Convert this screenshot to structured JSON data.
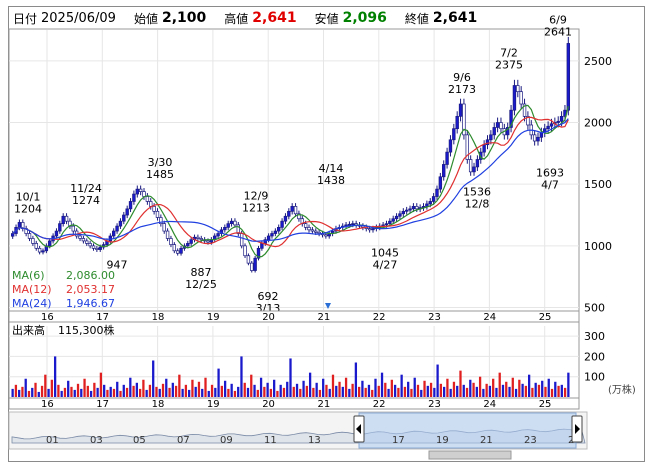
{
  "header": {
    "date_label": "日付",
    "date_value": "2025/06/09",
    "open_label": "始値",
    "open_value": "2,100",
    "high_label": "高値",
    "high_value": "2,641",
    "low_label": "安値",
    "low_value": "2,096",
    "close_label": "終値",
    "close_value": "2,641"
  },
  "legend": {
    "ma6_label": "MA(6)",
    "ma6_value": "2,086.00",
    "ma12_label": "MA(12)",
    "ma12_value": "2,053.17",
    "ma24_label": "MA(24)",
    "ma24_value": "1,946.67"
  },
  "volume": {
    "label": "出来高",
    "value": "115,300株",
    "unit": "(万株)"
  },
  "colors": {
    "up": "#1a1acc",
    "down": "#ffffff",
    "ma6": "#2e8b2e",
    "ma12": "#e03030",
    "ma24": "#2040e0",
    "vol_up": "#1a1acc",
    "vol_down": "#e02020"
  },
  "chart_data": [
    {
      "type": "candlestick",
      "ylim": [
        480,
        2750
      ],
      "y_ticks": [
        "2500",
        "2000",
        "1500",
        "1000",
        "500"
      ],
      "x_ticks": [
        "16",
        "17",
        "18",
        "19",
        "20",
        "21",
        "22",
        "23",
        "24",
        "25"
      ],
      "annotations": [
        {
          "date": "10/1",
          "value": "1204",
          "type": "high"
        },
        {
          "date": "11/24",
          "value": "1274",
          "type": "high"
        },
        {
          "date": "3/30",
          "value": "1485",
          "type": "high"
        },
        {
          "date": "12/9",
          "value": "1213",
          "type": "high"
        },
        {
          "date": "4/14",
          "value": "1438",
          "type": "high"
        },
        {
          "date": "9/6",
          "value": "2173",
          "type": "high"
        },
        {
          "date": "7/2",
          "value": "2375",
          "type": "high"
        },
        {
          "date": "6/9",
          "value": "2641",
          "type": "high"
        },
        {
          "date": "",
          "value": "947",
          "type": "low"
        },
        {
          "date": "12/25",
          "value": "887",
          "type": "low"
        },
        {
          "date": "3/13",
          "value": "692",
          "type": "low"
        },
        {
          "date": "4/27",
          "value": "1045",
          "type": "low"
        },
        {
          "date": "12/8",
          "value": "1536",
          "type": "low"
        },
        {
          "date": "4/7",
          "value": "1693",
          "type": "low"
        }
      ],
      "close_series": [
        1100,
        1150,
        1190,
        1140,
        1100,
        1060,
        1020,
        980,
        950,
        960,
        1000,
        1040,
        1080,
        1120,
        1180,
        1240,
        1200,
        1160,
        1120,
        1080,
        1060,
        1040,
        1020,
        1000,
        980,
        970,
        990,
        1010,
        1040,
        1080,
        1120,
        1160,
        1200,
        1250,
        1300,
        1360,
        1420,
        1460,
        1440,
        1400,
        1360,
        1320,
        1280,
        1230,
        1180,
        1120,
        1060,
        1010,
        960,
        940,
        980,
        1000,
        1020,
        1050,
        1070,
        1060,
        1050,
        1040,
        1030,
        1050,
        1080,
        1100,
        1130,
        1150,
        1180,
        1200,
        1170,
        1100,
        1000,
        920,
        860,
        800,
        900,
        980,
        1020,
        1050,
        1080,
        1100,
        1120,
        1150,
        1200,
        1240,
        1280,
        1320,
        1260,
        1220,
        1180,
        1150,
        1130,
        1120,
        1110,
        1100,
        1090,
        1080,
        1100,
        1120,
        1140,
        1150,
        1160,
        1170,
        1175,
        1180,
        1170,
        1160,
        1150,
        1140,
        1130,
        1140,
        1150,
        1160,
        1170,
        1180,
        1200,
        1220,
        1240,
        1260,
        1280,
        1290,
        1300,
        1320,
        1300,
        1310,
        1320,
        1340,
        1360,
        1400,
        1460,
        1560,
        1660,
        1760,
        1860,
        1950,
        2050,
        2150,
        1900,
        1700,
        1600,
        1640,
        1700,
        1760,
        1820,
        1860,
        1900,
        1960,
        2000,
        1950,
        1900,
        1960,
        2100,
        2300,
        2250,
        2150,
        2050,
        1980,
        1900,
        1850,
        1880,
        1920,
        1950,
        1970,
        1990,
        2000,
        2010,
        2050,
        2100,
        2641
      ]
    },
    {
      "type": "bar",
      "ylim": [
        0,
        350
      ],
      "y_ticks": [
        "300",
        "200",
        "100"
      ],
      "x_ticks": [
        "16",
        "17",
        "18",
        "19",
        "20",
        "21",
        "22",
        "23",
        "24",
        "25"
      ],
      "values": [
        40,
        60,
        35,
        50,
        90,
        30,
        45,
        70,
        25,
        55,
        110,
        40,
        85,
        200,
        60,
        30,
        45,
        80,
        50,
        35,
        65,
        40,
        90,
        55,
        30,
        70,
        45,
        120,
        60,
        35,
        50,
        40,
        75,
        30,
        60,
        45,
        95,
        55,
        70,
        40,
        85,
        35,
        60,
        180,
        50,
        40,
        65,
        90,
        45,
        70,
        55,
        110,
        40,
        60,
        35,
        85,
        50,
        75,
        40,
        95,
        30,
        60,
        45,
        140,
        55,
        80,
        40,
        65,
        30,
        50,
        200,
        70,
        45,
        110,
        60,
        35,
        95,
        50,
        70,
        40,
        85,
        30,
        60,
        45,
        75,
        190,
        50,
        65,
        40,
        80,
        55,
        120,
        45,
        70,
        35,
        90,
        60,
        40,
        110,
        55,
        75,
        50,
        95,
        40,
        65,
        170,
        50,
        80,
        45,
        60,
        35,
        90,
        55,
        120,
        70,
        40,
        85,
        60,
        45,
        110,
        50,
        75,
        40,
        95,
        60,
        35,
        80,
        55,
        70,
        45,
        160,
        65,
        50,
        90,
        40,
        75,
        55,
        130,
        60,
        45,
        85,
        70,
        50,
        100,
        40,
        65,
        55,
        90,
        45,
        120,
        60,
        75,
        50,
        95,
        40,
        85,
        65,
        55,
        110,
        45,
        70,
        60,
        80,
        50,
        90,
        40,
        75,
        55,
        60,
        45,
        120
      ],
      "up": [
        true,
        false,
        true,
        false,
        true,
        false,
        true,
        false,
        true,
        false,
        false,
        true,
        false,
        true,
        false,
        true,
        false,
        true,
        false,
        true,
        false,
        true,
        false,
        false,
        true,
        false,
        true,
        false,
        true,
        false,
        true,
        false,
        true,
        false,
        true,
        false,
        true,
        false,
        true,
        false,
        false,
        true,
        false,
        true,
        false,
        true,
        false,
        true,
        false,
        true,
        false,
        false,
        true,
        false,
        true,
        false,
        true,
        false,
        true,
        false,
        true,
        false,
        true,
        true,
        false,
        true,
        false,
        true,
        false,
        true,
        true,
        false,
        true,
        false,
        true,
        false,
        true,
        false,
        true,
        false,
        true,
        false,
        true,
        false,
        true,
        true,
        false,
        true,
        false,
        true,
        false,
        true,
        false,
        true,
        false,
        true,
        false,
        true,
        false,
        true,
        false,
        true,
        false,
        true,
        false,
        true,
        false,
        true,
        false,
        true,
        false,
        true,
        false,
        true,
        false,
        true,
        false,
        true,
        false,
        true,
        false,
        true,
        false,
        true,
        false,
        true,
        false,
        true,
        false,
        true,
        true,
        false,
        true,
        false,
        true,
        false,
        true,
        false,
        true,
        false,
        true,
        false,
        true,
        false,
        true,
        false,
        true,
        false,
        true,
        false,
        true,
        false,
        true,
        false,
        true,
        false,
        true,
        false,
        true,
        false,
        true,
        false,
        true,
        false,
        true,
        false,
        true,
        false,
        true,
        false,
        true
      ]
    },
    {
      "type": "area",
      "x_ticks": [
        "01",
        "03",
        "05",
        "07",
        "09",
        "11",
        "13",
        "17",
        "19",
        "21",
        "23",
        "2"
      ]
    }
  ]
}
